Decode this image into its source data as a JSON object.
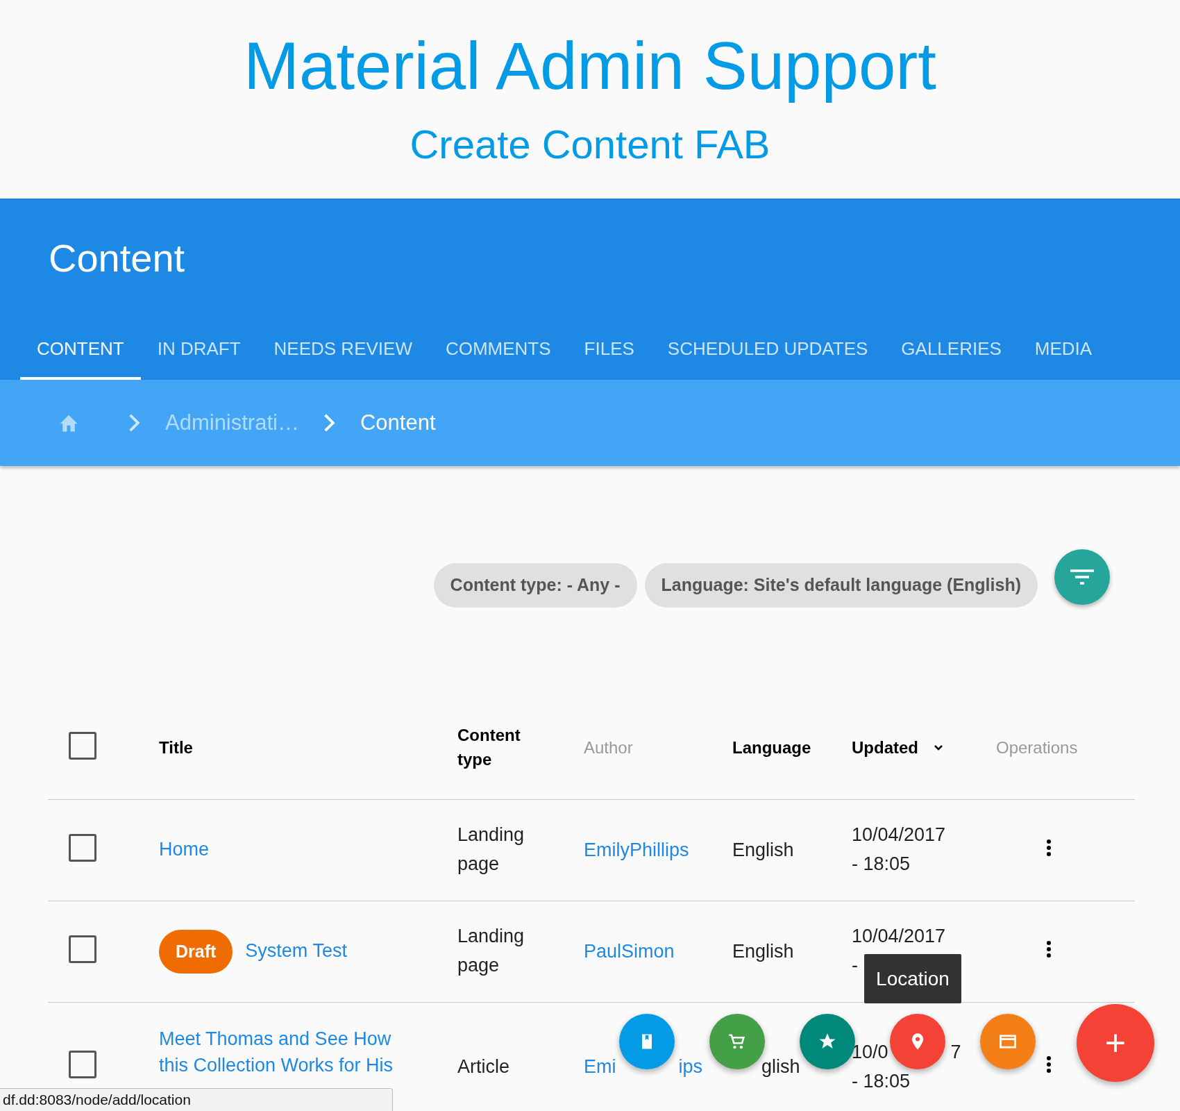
{
  "header": {
    "title": "Material Admin Support",
    "subtitle": "Create Content FAB"
  },
  "page_title": "Content",
  "tabs": [
    {
      "label": "CONTENT",
      "selected": true
    },
    {
      "label": "IN DRAFT",
      "selected": false
    },
    {
      "label": "NEEDS REVIEW",
      "selected": false
    },
    {
      "label": "COMMENTS",
      "selected": false
    },
    {
      "label": "FILES",
      "selected": false
    },
    {
      "label": "SCHEDULED UPDATES",
      "selected": false
    },
    {
      "label": "GALLERIES",
      "selected": false
    },
    {
      "label": "MEDIA",
      "selected": false
    }
  ],
  "breadcrumb": [
    "Administrati…",
    "Content"
  ],
  "filters": [
    "Content type: - Any -",
    "Language: Site's default language (English)"
  ],
  "table": {
    "select_all": {
      "checked": false
    },
    "columns": [
      {
        "label": "Title",
        "sortable": true,
        "sorted": false
      },
      {
        "label": "Content type",
        "sortable": true,
        "sorted": false
      },
      {
        "label": "Author",
        "sortable": false,
        "sorted": false
      },
      {
        "label": "Language",
        "sortable": true,
        "sorted": false
      },
      {
        "label": "Updated",
        "sortable": true,
        "sorted": true
      },
      {
        "label": "Operations",
        "sortable": false,
        "sorted": false
      }
    ],
    "rows": [
      {
        "checked": false,
        "title": "Home",
        "content_type": "Landing page",
        "author": [
          "EmilyPhillips"
        ],
        "language": [
          "English"
        ],
        "updated": [
          [
            "10/04/2017"
          ],
          [
            "- 18:05"
          ]
        ]
      },
      {
        "checked": false,
        "badge": "Draft",
        "title": "System Test",
        "content_type": "Landing page",
        "author": [
          "PaulSimon"
        ],
        "language": [
          "English"
        ],
        "updated": [
          [
            "10/04/2017"
          ],
          [
            "-"
          ]
        ]
      },
      {
        "checked": false,
        "partly_hidden": true,
        "title": "Meet Thomas and See How this Collection Works for His",
        "content_type": "Article",
        "author": [
          "Emi",
          "ips"
        ],
        "language": [
          "glish"
        ],
        "updated": [
          [
            "10/0",
            "7"
          ],
          [
            "- 18:05"
          ]
        ]
      }
    ]
  },
  "fab_menu": {
    "items": [
      {
        "kind": "book",
        "color": "#039be5"
      },
      {
        "kind": "cart",
        "color": "#43a047"
      },
      {
        "kind": "star",
        "color": "#00897b"
      },
      {
        "kind": "location",
        "color": "#f44336"
      },
      {
        "kind": "window",
        "color": "#f57f17"
      }
    ],
    "tooltip": "Location",
    "main": "+"
  },
  "status_bar": "df.dd:8083/node/add/location"
}
